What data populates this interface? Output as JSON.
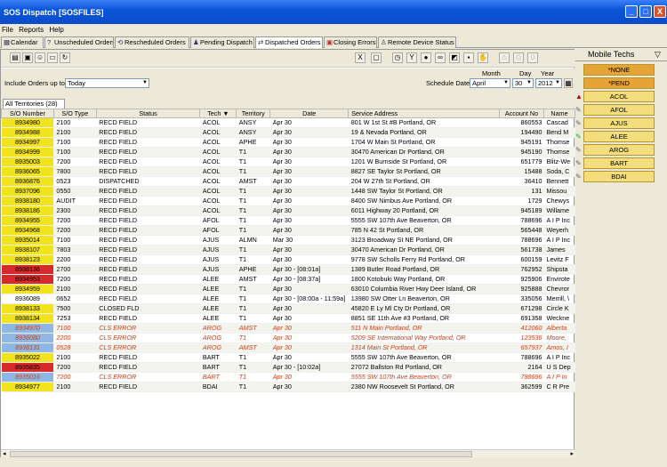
{
  "window": {
    "title": "SOS Dispatch  [SOSFILES]",
    "controls": [
      "_",
      "□",
      "X"
    ]
  },
  "menu": [
    "File",
    "Reports",
    "Help"
  ],
  "tabs": [
    {
      "label": "Calendar",
      "icon": "calendar-icon"
    },
    {
      "label": "Unscheduled Orders",
      "icon": "question-icon"
    },
    {
      "label": "Rescheduled Orders",
      "icon": "reschedule-icon"
    },
    {
      "label": "Pending Dispatch",
      "icon": "pending-icon"
    },
    {
      "label": "Dispatched Orders",
      "icon": "dispatch-icon"
    },
    {
      "label": "Closing Errors",
      "icon": "error-icon"
    },
    {
      "label": "Remote Device Status",
      "icon": "device-icon"
    }
  ],
  "filter": {
    "include_label": "Include Orders up to",
    "include_value": "Today",
    "schedule_label": "Schedule Date",
    "month_label": "Month",
    "day_label": "Day",
    "year_label": "Year",
    "month": "April",
    "day": "30",
    "year": "2012"
  },
  "territory_tab": "All Territories (28)",
  "columns": [
    "S/O Number",
    "S/O Type",
    "Status",
    "Tech",
    "Territory",
    "Date",
    "Service Address",
    "Account No",
    "Name"
  ],
  "rows": [
    {
      "so": "8934980",
      "type": "2100",
      "status": "RECD FIELD",
      "tech": "ACOL",
      "terr": "ANSY",
      "date": "Apr 30",
      "addr": "801 W 1st St #B Portland, OR",
      "acct": "860553",
      "name": "Cascad",
      "flag": "yellow"
    },
    {
      "so": "8934988",
      "type": "2100",
      "status": "RECD FIELD",
      "tech": "ACOL",
      "terr": "ANSY",
      "date": "Apr 30",
      "addr": "19 & Nevada Portland, OR",
      "acct": "194490",
      "name": "Bend M",
      "flag": "yellow"
    },
    {
      "so": "8934997",
      "type": "7100",
      "status": "RECD FIELD",
      "tech": "ACOL",
      "terr": "APHE",
      "date": "Apr 30",
      "addr": "1704 W Main St Portland, OR",
      "acct": "945191",
      "name": "Thomse",
      "flag": "yellow"
    },
    {
      "so": "8934999",
      "type": "7100",
      "status": "RECD FIELD",
      "tech": "ACOL",
      "terr": "T1",
      "date": "Apr 30",
      "addr": "30470 American Dr Portland, OR",
      "acct": "945190",
      "name": "Thomse",
      "flag": "yellow"
    },
    {
      "so": "8935003",
      "type": "7200",
      "status": "RECD FIELD",
      "tech": "ACOL",
      "terr": "T1",
      "date": "Apr 30",
      "addr": "1201 W Burnside St Portland, OR",
      "acct": "651779",
      "name": "Blitz-We",
      "flag": "yellow"
    },
    {
      "so": "8936065",
      "type": "7800",
      "status": "RECD FIELD",
      "tech": "ACOL",
      "terr": "T1",
      "date": "Apr 30",
      "addr": "8827 SE Taylor St Portland, OR",
      "acct": "15488",
      "name": "Soda, C",
      "flag": "yellow"
    },
    {
      "so": "8936876",
      "type": "0523",
      "status": "DISPATCHED",
      "tech": "ACOL",
      "terr": "AMST",
      "date": "Apr 30",
      "addr": "204 W 27th St Portland, OR",
      "acct": "36410",
      "name": "Bennett",
      "flag": "yellow"
    },
    {
      "so": "8937096",
      "type": "0550",
      "status": "RECD FIELD",
      "tech": "ACOL",
      "terr": "T1",
      "date": "Apr 30",
      "addr": "1448 SW Taylor St Portland, OR",
      "acct": "131",
      "name": "Missou",
      "flag": "yellow"
    },
    {
      "so": "8938180",
      "type": "AUDIT",
      "status": "RECD FIELD",
      "tech": "ACOL",
      "terr": "T1",
      "date": "Apr 30",
      "addr": "8400 SW Nimbus Ave Portland, OR",
      "acct": "1729",
      "name": "Chewys",
      "flag": "yellow"
    },
    {
      "so": "8938186",
      "type": "2300",
      "status": "RECD FIELD",
      "tech": "ACOL",
      "terr": "T1",
      "date": "Apr 30",
      "addr": "6011 Highway 20 Portland, OR",
      "acct": "945189",
      "name": "Willame",
      "flag": "yellow"
    },
    {
      "so": "8934955",
      "type": "7200",
      "status": "RECD FIELD",
      "tech": "AFOL",
      "terr": "T1",
      "date": "Apr 30",
      "addr": "5555 SW 107th Ave Beaverton, OR",
      "acct": "788696",
      "name": "A I P Inc",
      "flag": "yellow"
    },
    {
      "so": "8934968",
      "type": "7200",
      "status": "RECD FIELD",
      "tech": "AFOL",
      "terr": "T1",
      "date": "Apr 30",
      "addr": "785 N 42 St Portland, OR",
      "acct": "565448",
      "name": "Weyerh",
      "flag": "yellow"
    },
    {
      "so": "8935014",
      "type": "7100",
      "status": "RECD FIELD",
      "tech": "AJUS",
      "terr": "ALMN",
      "date": "Mar 30",
      "addr": "3123 Broadway St NE Portland, OR",
      "acct": "788696",
      "name": "A I P Inc",
      "flag": "yellow"
    },
    {
      "so": "8938107",
      "type": "7803",
      "status": "RECD FIELD",
      "tech": "AJUS",
      "terr": "T1",
      "date": "Apr 30",
      "addr": "30470 American Dr Portland, OR",
      "acct": "561738",
      "name": "James",
      "flag": "yellow"
    },
    {
      "so": "8938123",
      "type": "2200",
      "status": "RECD FIELD",
      "tech": "AJUS",
      "terr": "T1",
      "date": "Apr 30",
      "addr": "9778 SW Scholls Ferry Rd Portland, OR",
      "acct": "600159",
      "name": "Levitz F",
      "flag": "yellow"
    },
    {
      "so": "8938136",
      "type": "2700",
      "status": "RECD FIELD",
      "tech": "AJUS",
      "terr": "APHE",
      "date": "Apr 30 - [08:01a]",
      "addr": "1389 Butler Road Portland, OR",
      "acct": "762952",
      "name": "Shipsta",
      "flag": "red"
    },
    {
      "so": "8934953",
      "type": "7200",
      "status": "RECD FIELD",
      "tech": "ALEE",
      "terr": "AMST",
      "date": "Apr 30 - [08:37a]",
      "addr": "1800 Kotobuki Way Portland, OR",
      "acct": "925906",
      "name": "Envirote",
      "flag": "red"
    },
    {
      "so": "8934959",
      "type": "2100",
      "status": "RECD FIELD",
      "tech": "ALEE",
      "terr": "T1",
      "date": "Apr 30",
      "addr": "63010 Columbia River Hwy Deer Island, OR",
      "acct": "925888",
      "name": "Chevror",
      "flag": "yellow"
    },
    {
      "so": "8936089",
      "type": "0652",
      "status": "RECD FIELD",
      "tech": "ALEE",
      "terr": "T1",
      "date": "Apr 30 - [08:00a - 11:59a]",
      "addr": "13980 SW Otter Ln Beaverton, OR",
      "acct": "335056",
      "name": "Merrill, \\",
      "flag": "none"
    },
    {
      "so": "8938133",
      "type": "7500",
      "status": "CLOSED FLD",
      "tech": "ALEE",
      "terr": "T1",
      "date": "Apr 30",
      "addr": "45820 E Ly Ml Cty Dr Portland, OR",
      "acct": "671298",
      "name": "Circle K",
      "flag": "yellow"
    },
    {
      "so": "8938134",
      "type": "7253",
      "status": "RECD FIELD",
      "tech": "ALEE",
      "terr": "T1",
      "date": "Apr 30",
      "addr": "8851 SE 11th Ave #3 Portland, OR",
      "acct": "691358",
      "name": "Weckne",
      "flag": "yellow"
    },
    {
      "so": "8934970",
      "type": "7100",
      "status": "CLS ERROR",
      "tech": "AROG",
      "terr": "AMST",
      "date": "Apr 30",
      "addr": "511 N Main Portland, OR",
      "acct": "412060",
      "name": "Alberta",
      "flag": "blue",
      "err": true
    },
    {
      "so": "8936080",
      "type": "2200",
      "status": "CLS ERROR",
      "tech": "AROG",
      "terr": "T1",
      "date": "Apr 30",
      "addr": "5209 SE International Way Portland, OR",
      "acct": "123536",
      "name": "Moore,",
      "flag": "blue",
      "err": true
    },
    {
      "so": "8938131",
      "type": "0528",
      "status": "CLS ERROR",
      "tech": "AROG",
      "terr": "AMST",
      "date": "Apr 30",
      "addr": "1314 Main St Portland, OR",
      "acct": "657937",
      "name": "Amos, I",
      "flag": "blue",
      "err": true
    },
    {
      "so": "8935022",
      "type": "2100",
      "status": "RECD FIELD",
      "tech": "BART",
      "terr": "T1",
      "date": "Apr 30",
      "addr": "5555 SW 107th Ave Beaverton, OR",
      "acct": "788696",
      "name": "A I P Inc",
      "flag": "yellow"
    },
    {
      "so": "8935835",
      "type": "7200",
      "status": "RECD FIELD",
      "tech": "BART",
      "terr": "T1",
      "date": "Apr 30 - [10:02a]",
      "addr": "27072 Ballston Rd Portland, OR",
      "acct": "2164",
      "name": "U S Dep",
      "flag": "red"
    },
    {
      "so": "8935016",
      "type": "7200",
      "status": "CLS ERROR",
      "tech": "BART",
      "terr": "T1",
      "date": "Apr 30",
      "addr": "5555 SW 107th Ave Beaverton, OR",
      "acct": "788696",
      "name": "A I P In",
      "flag": "blue",
      "err": true
    },
    {
      "so": "8934977",
      "type": "2100",
      "status": "RECD FIELD",
      "tech": "BDAI",
      "terr": "T1",
      "date": "Apr 30",
      "addr": "2380 NW Roosevelt St Portland, OR",
      "acct": "362599",
      "name": "C R Pre",
      "flag": "yellow"
    }
  ],
  "right_panel": {
    "title": "Mobile Techs",
    "techs": [
      "*NONE",
      "*PEND",
      "ACOL",
      "AFOL",
      "AJUS",
      "ALEE",
      "AROG",
      "BART",
      "BDAI"
    ]
  }
}
